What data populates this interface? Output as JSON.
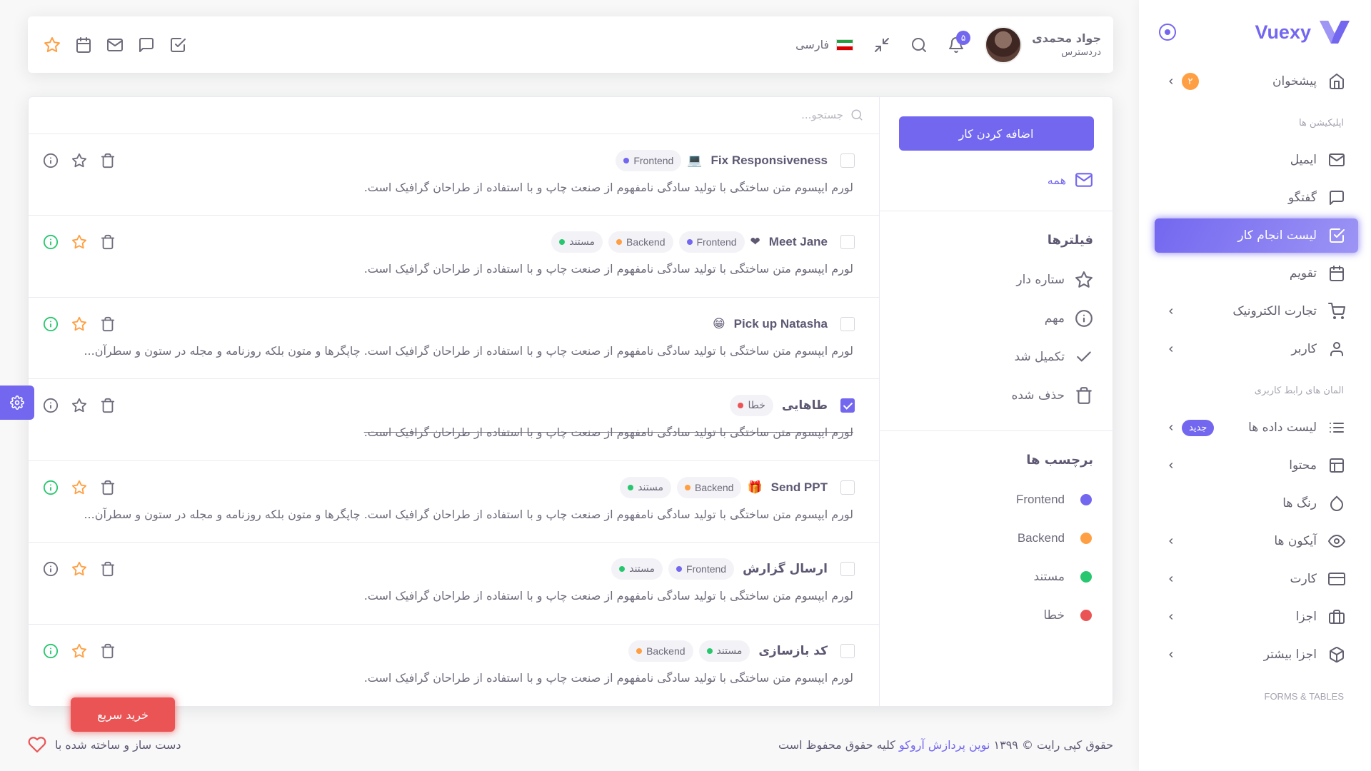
{
  "brand": {
    "name": "Vuexy"
  },
  "sidebar": {
    "dashboard": {
      "label": "پیشخوان",
      "badge": "۲"
    },
    "apps_header": "اپلیکیشن ها",
    "apps": [
      {
        "label": "ایمیل",
        "icon": "mail-icon"
      },
      {
        "label": "گفتگو",
        "icon": "chat-icon"
      },
      {
        "label": "لیست انجام کار",
        "icon": "check-square-icon",
        "active": true
      },
      {
        "label": "تقویم",
        "icon": "calendar-icon"
      },
      {
        "label": "تجارت الکترونیک",
        "icon": "cart-icon"
      },
      {
        "label": "کاربر",
        "icon": "user-icon"
      }
    ],
    "ui_header": "المان های رابط کاربری",
    "ui": [
      {
        "label": "لیست داده ها",
        "icon": "list-icon",
        "badge": "جدید"
      },
      {
        "label": "محتوا",
        "icon": "layout-icon"
      },
      {
        "label": "رنگ ها",
        "icon": "droplet-icon"
      },
      {
        "label": "آیکون ها",
        "icon": "eye-icon"
      },
      {
        "label": "کارت",
        "icon": "credit-card-icon"
      },
      {
        "label": "اجزا",
        "icon": "briefcase-icon"
      },
      {
        "label": "اجزا بیشتر",
        "icon": "box-icon"
      }
    ],
    "forms_header": "FORMS & TABLES"
  },
  "navbar": {
    "user_name": "جواد محمدی",
    "user_role": "دردسترس",
    "notifications": "۵",
    "language": "فارسی"
  },
  "todo": {
    "add_button": "اضافه کردن کار",
    "all_label": "همه",
    "filters_title": "فیلترها",
    "filters": [
      {
        "label": "ستاره دار",
        "icon": "star-icon"
      },
      {
        "label": "مهم",
        "icon": "info-icon"
      },
      {
        "label": "تکمیل شد",
        "icon": "check-icon"
      },
      {
        "label": "حذف شده",
        "icon": "trash-icon"
      }
    ],
    "tags_title": "برچسب ها",
    "tags": [
      {
        "label": "Frontend",
        "color": "#7367f0"
      },
      {
        "label": "Backend",
        "color": "#ff9f43"
      },
      {
        "label": "مستند",
        "color": "#28c76f"
      },
      {
        "label": "خطا",
        "color": "#ea5455"
      }
    ],
    "search_placeholder": "جستجو...",
    "tasks": [
      {
        "title": "Fix Responsiveness",
        "emoji": "💻",
        "tags": [
          "Frontend"
        ],
        "starred": false,
        "important": false,
        "done": false,
        "desc": "لورم ایپسوم متن ساختگی با تولید سادگی نامفهوم از صنعت چاپ و با استفاده از طراحان گرافیک است."
      },
      {
        "title": "Meet Jane",
        "emoji": "❤",
        "tags": [
          "Frontend",
          "Backend",
          "مستند"
        ],
        "starred": true,
        "important": true,
        "done": false,
        "desc": "لورم ایپسوم متن ساختگی با تولید سادگی نامفهوم از صنعت چاپ و با استفاده از طراحان گرافیک است."
      },
      {
        "title": "Pick up Natasha",
        "emoji": "😁",
        "tags": [],
        "starred": true,
        "important": true,
        "done": false,
        "desc": "لورم ایپسوم متن ساختگی با تولید سادگی نامفهوم از صنعت چاپ و با استفاده از طراحان گرافیک است. چاپگرها و متون بلکه روزنامه و مجله در ستون و سطرآن..."
      },
      {
        "title": "طاهایی",
        "emoji": "",
        "tags": [
          "خطا"
        ],
        "starred": false,
        "important": false,
        "done": true,
        "desc": "لورم ایپسوم متن ساختگی با تولید سادگی نامفهوم از صنعت چاپ و با استفاده از طراحان گرافیک است."
      },
      {
        "title": "Send PPT",
        "emoji": "🎁",
        "tags": [
          "Backend",
          "مستند"
        ],
        "starred": true,
        "important": true,
        "done": false,
        "desc": "لورم ایپسوم متن ساختگی با تولید سادگی نامفهوم از صنعت چاپ و با استفاده از طراحان گرافیک است. چاپگرها و متون بلکه روزنامه و مجله در ستون و سطرآن..."
      },
      {
        "title": "ارسال گزارش",
        "emoji": "",
        "tags": [
          "Frontend",
          "مستند"
        ],
        "starred": true,
        "important": false,
        "done": false,
        "desc": "لورم ایپسوم متن ساختگی با تولید سادگی نامفهوم از صنعت چاپ و با استفاده از طراحان گرافیک است."
      },
      {
        "title": "کد بازسازی",
        "emoji": "",
        "tags": [
          "مستند",
          "Backend"
        ],
        "starred": true,
        "important": true,
        "done": false,
        "desc": "لورم ایپسوم متن ساختگی با تولید سادگی نامفهوم از صنعت چاپ و با استفاده از طراحان گرافیک است."
      }
    ]
  },
  "buy_button": "خرید سریع",
  "footer": {
    "copyright_prefix": "حقوق کپی رایت © ۱۳۹۹",
    "company": "نوین پردازش آروکو",
    "copyright_suffix": "کلیه حقوق محفوظ است",
    "made_with": "دست ساز و ساخته شده با"
  },
  "colors": {
    "primary": "#7367f0",
    "warning": "#ff9f43",
    "success": "#28c76f",
    "danger": "#ea5455"
  }
}
